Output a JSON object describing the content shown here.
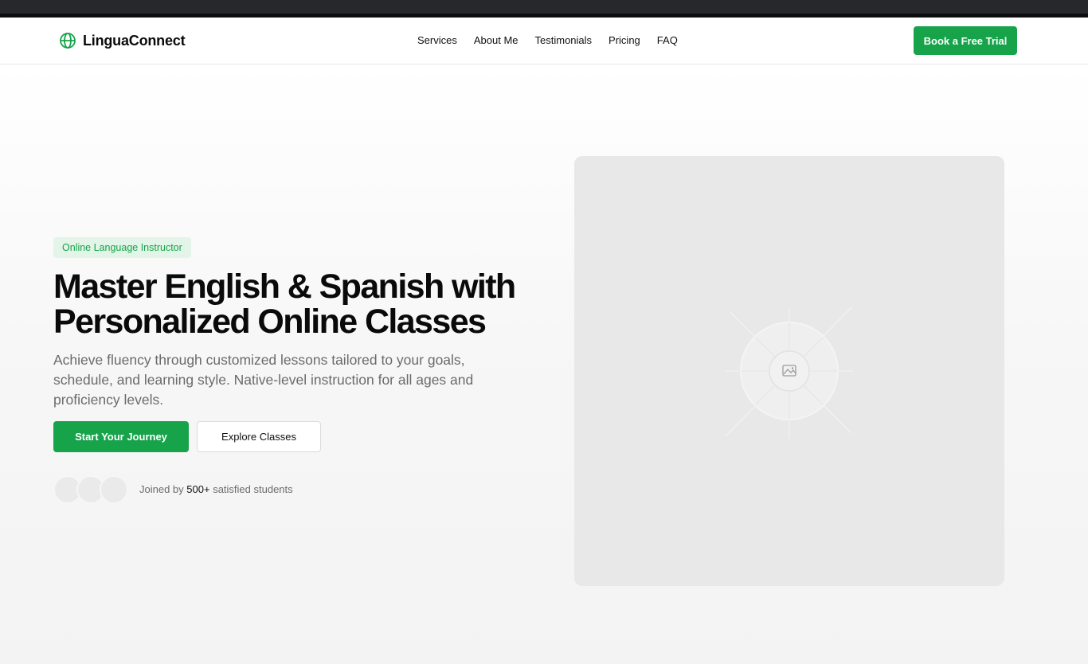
{
  "nav": {
    "brand": "LinguaConnect",
    "links": [
      "Services",
      "About Me",
      "Testimonials",
      "Pricing",
      "FAQ"
    ],
    "cta": "Book a Free Trial"
  },
  "hero": {
    "badge": "Online Language Instructor",
    "headline_line1": "Master English & Spanish with",
    "headline_line2": "Personalized Online Classes",
    "subtext": "Achieve fluency through customized lessons tailored to your goals, schedule, and learning style. Native-level instruction for all ages and proficiency levels.",
    "primary_cta": "Start Your Journey",
    "secondary_cta": "Explore Classes",
    "social_proof": {
      "prefix": "Joined by",
      "count": "500+",
      "suffix": "satisfied students"
    }
  },
  "icons": {
    "brand": "globe-icon",
    "media": "image-placeholder-icon"
  },
  "colors": {
    "accent": "#16a34a",
    "badge_bg": "#e3f4e8",
    "topbar": "#27282b"
  }
}
